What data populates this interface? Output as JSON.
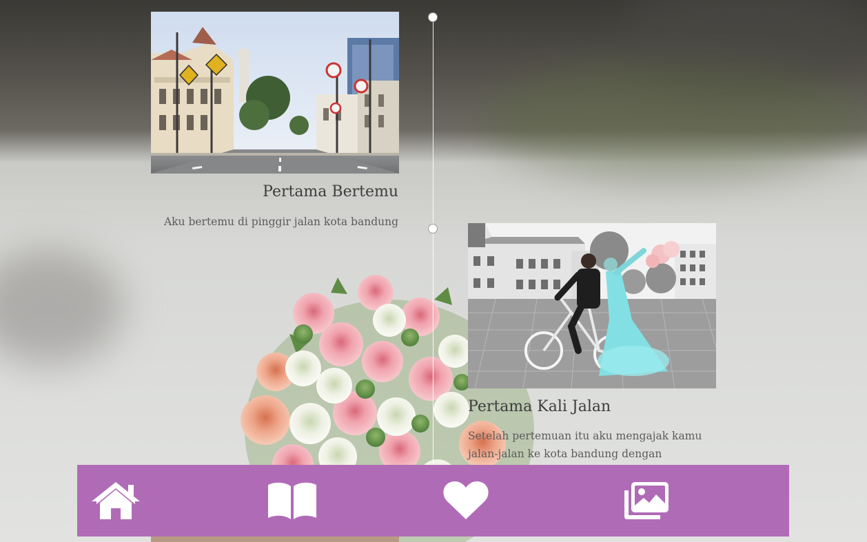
{
  "timeline": {
    "items": [
      {
        "title": "Pertama Bertemu",
        "description": "Aku bertemu di pinggir jalan kota bandung",
        "image": "city-street-photo"
      },
      {
        "title": "Pertama Kali Jalan",
        "description": "Setelah pertemuan itu aku mengajak kamu jalan-jalan ke kota bandung dengan",
        "image": "couple-bicycle-photo"
      }
    ]
  },
  "nav": {
    "items": [
      {
        "icon": "home-icon"
      },
      {
        "icon": "book-open-icon"
      },
      {
        "icon": "heart-icon"
      },
      {
        "icon": "images-icon"
      }
    ]
  },
  "colors": {
    "nav_background": "#b06bb7",
    "nav_icon": "#ffffff",
    "timeline_line": "#ffffff",
    "title_text": "#3d3d3d",
    "body_text": "#5b5b5b"
  }
}
